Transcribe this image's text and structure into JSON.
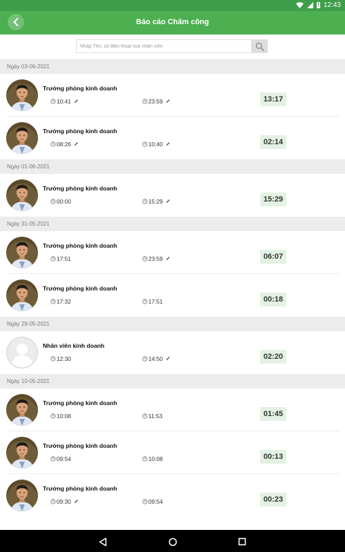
{
  "status": {
    "time": "12:43",
    "battery_label": "!"
  },
  "header": {
    "title": "Báo cáo Chấm công"
  },
  "search": {
    "placeholder": "Nhập Tên, số điện thoại của nhân viên"
  },
  "sections": [
    {
      "date": "Ngày 03-06-2021",
      "items": [
        {
          "name": "Trưởng phòng kinh doanh",
          "avatar": "photo",
          "time_in": "10:41",
          "in_edited": true,
          "time_out": "23:59",
          "out_edited": true,
          "duration": "13:17"
        },
        {
          "name": "Trưởng phòng kinh doanh",
          "avatar": "photo",
          "time_in": "08:26",
          "in_edited": true,
          "time_out": "10:40",
          "out_edited": true,
          "duration": "02:14"
        }
      ]
    },
    {
      "date": "Ngày 01-06-2021",
      "items": [
        {
          "name": "Trưởng phòng kinh doanh",
          "avatar": "photo",
          "time_in": "00:00",
          "in_edited": false,
          "time_out": "15:29",
          "out_edited": true,
          "duration": "15:29"
        }
      ]
    },
    {
      "date": "Ngày 31-05-2021",
      "items": [
        {
          "name": "Trưởng phòng kinh doanh",
          "avatar": "photo",
          "time_in": "17:51",
          "in_edited": false,
          "time_out": "23:59",
          "out_edited": true,
          "duration": "06:07"
        },
        {
          "name": "Trưởng phòng kinh doanh",
          "avatar": "photo",
          "time_in": "17:32",
          "in_edited": false,
          "time_out": "17:51",
          "out_edited": false,
          "duration": "00:18"
        }
      ]
    },
    {
      "date": "Ngày 29-05-2021",
      "items": [
        {
          "name": "Nhân viên kinh doanh",
          "avatar": "placeholder",
          "time_in": "12:30",
          "in_edited": false,
          "time_out": "14:50",
          "out_edited": true,
          "duration": "02:20"
        }
      ]
    },
    {
      "date": "Ngày 10-05-2021",
      "items": [
        {
          "name": "Trưởng phòng kinh doanh",
          "avatar": "photo",
          "time_in": "10:08",
          "in_edited": false,
          "time_out": "11:53",
          "out_edited": false,
          "duration": "01:45"
        },
        {
          "name": "Trưởng phòng kinh doanh",
          "avatar": "photo",
          "time_in": "09:54",
          "in_edited": false,
          "time_out": "10:08",
          "out_edited": false,
          "duration": "00:13"
        },
        {
          "name": "Trưởng phòng kinh doanh",
          "avatar": "photo",
          "time_in": "09:30",
          "in_edited": true,
          "time_out": "09:54",
          "out_edited": false,
          "duration": "00:23"
        }
      ]
    }
  ],
  "colors": {
    "primary": "#4caf50",
    "status_bar": "#3f9e49",
    "duration_bg": "#e3f2e3",
    "section_bg": "#ececec"
  },
  "icons": {
    "back": "chevron-left-icon",
    "search": "search-icon",
    "clock": "clock-icon",
    "edit": "pencil-icon"
  }
}
